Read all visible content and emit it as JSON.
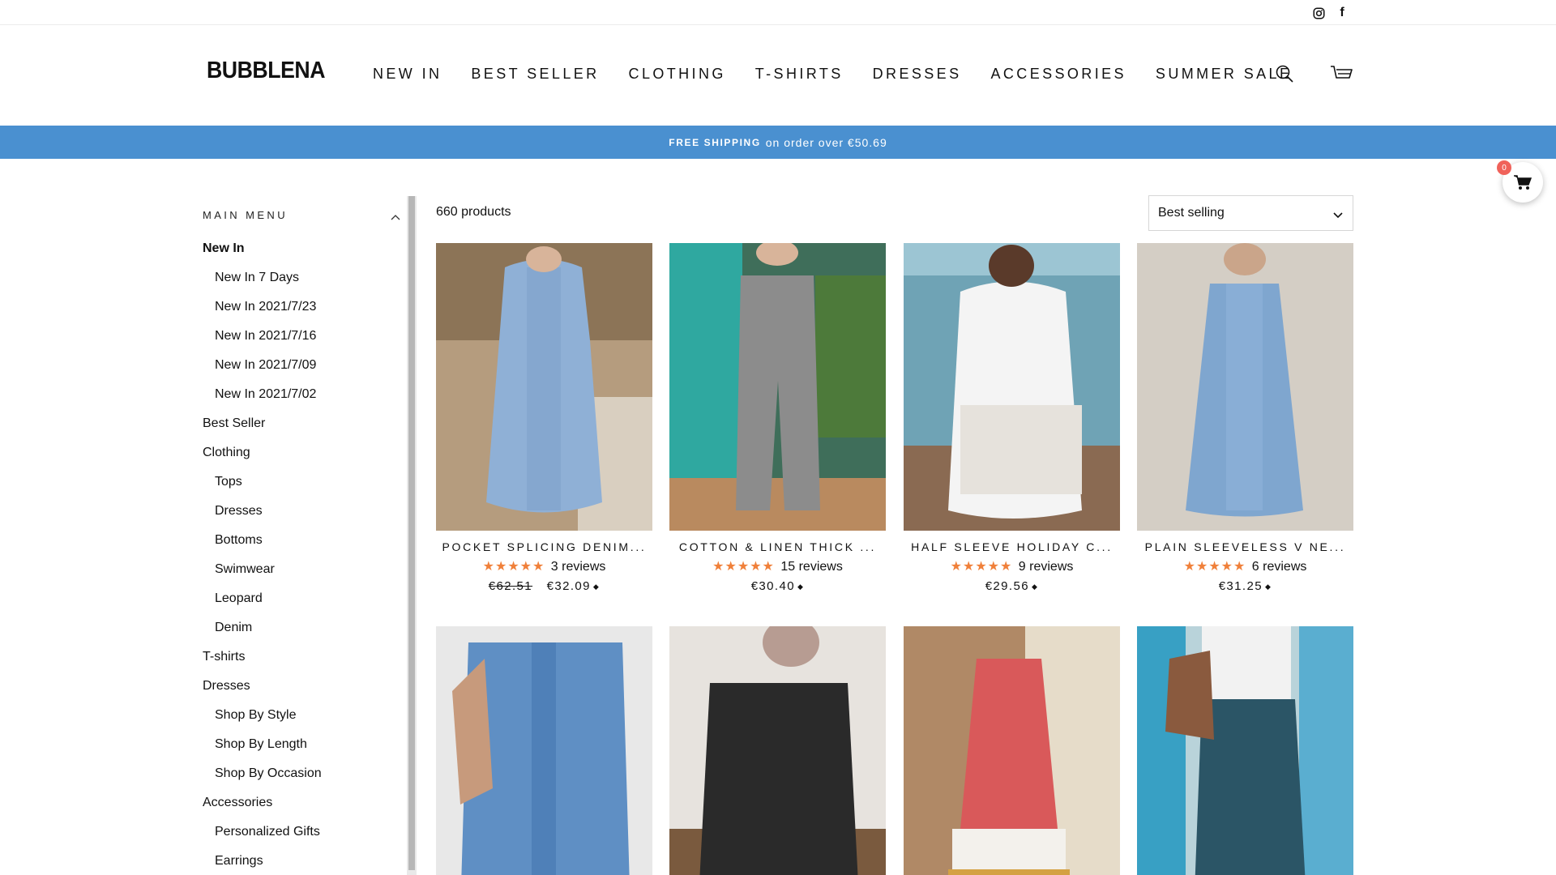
{
  "header": {
    "logo": "BUBBLENA",
    "nav": [
      "NEW IN",
      "BEST SELLER",
      "CLOTHING",
      "T-SHIRTS",
      "DRESSES",
      "ACCESSORIES",
      "SUMMER SALE"
    ],
    "icons": [
      "instagram-icon",
      "facebook-icon",
      "search-icon",
      "cart-icon"
    ]
  },
  "announcement": {
    "bold": "FREE SHIPPING",
    "text": "on order over €50.69",
    "color": "#4a90d0"
  },
  "floating_cart": {
    "count": "0"
  },
  "sidebar": {
    "heading": "MAIN MENU",
    "items": [
      {
        "label": "New In",
        "level": 0,
        "active": true
      },
      {
        "label": "New In 7 Days",
        "level": 1
      },
      {
        "label": "New In 2021/7/23",
        "level": 1
      },
      {
        "label": "New In 2021/7/16",
        "level": 1
      },
      {
        "label": "New In 2021/7/09",
        "level": 1
      },
      {
        "label": "New In 2021/7/02",
        "level": 1
      },
      {
        "label": "Best Seller",
        "level": 0
      },
      {
        "label": "Clothing",
        "level": 0
      },
      {
        "label": "Tops",
        "level": 1
      },
      {
        "label": "Dresses",
        "level": 1
      },
      {
        "label": "Bottoms",
        "level": 1
      },
      {
        "label": "Swimwear",
        "level": 1
      },
      {
        "label": "Leopard",
        "level": 1
      },
      {
        "label": "Denim",
        "level": 1
      },
      {
        "label": "T-shirts",
        "level": 0
      },
      {
        "label": "Dresses",
        "level": 0
      },
      {
        "label": "Shop By Style",
        "level": 1
      },
      {
        "label": "Shop By Length",
        "level": 1
      },
      {
        "label": "Shop By Occasion",
        "level": 1
      },
      {
        "label": "Accessories",
        "level": 0
      },
      {
        "label": "Personalized Gifts",
        "level": 1
      },
      {
        "label": "Earrings",
        "level": 1
      }
    ]
  },
  "listing": {
    "count": "660 products",
    "sort": "Best selling"
  },
  "products": [
    {
      "title": "POCKET SPLICING DENIM...",
      "stars": "★★★★★",
      "reviews": "3 reviews",
      "old_price": "€62.51",
      "price": "€32.09"
    },
    {
      "title": "COTTON & LINEN THICK ...",
      "stars": "★★★★★",
      "reviews": "15 reviews",
      "old_price": "",
      "price": "€30.40"
    },
    {
      "title": "HALF SLEEVE HOLIDAY C...",
      "stars": "★★★★★",
      "reviews": "9 reviews",
      "old_price": "",
      "price": "€29.56"
    },
    {
      "title": "PLAIN SLEEVELESS V NE...",
      "stars": "★★★★★",
      "reviews": "6 reviews",
      "old_price": "",
      "price": "€31.25"
    }
  ],
  "currency_icon": "currency-switch-icon"
}
